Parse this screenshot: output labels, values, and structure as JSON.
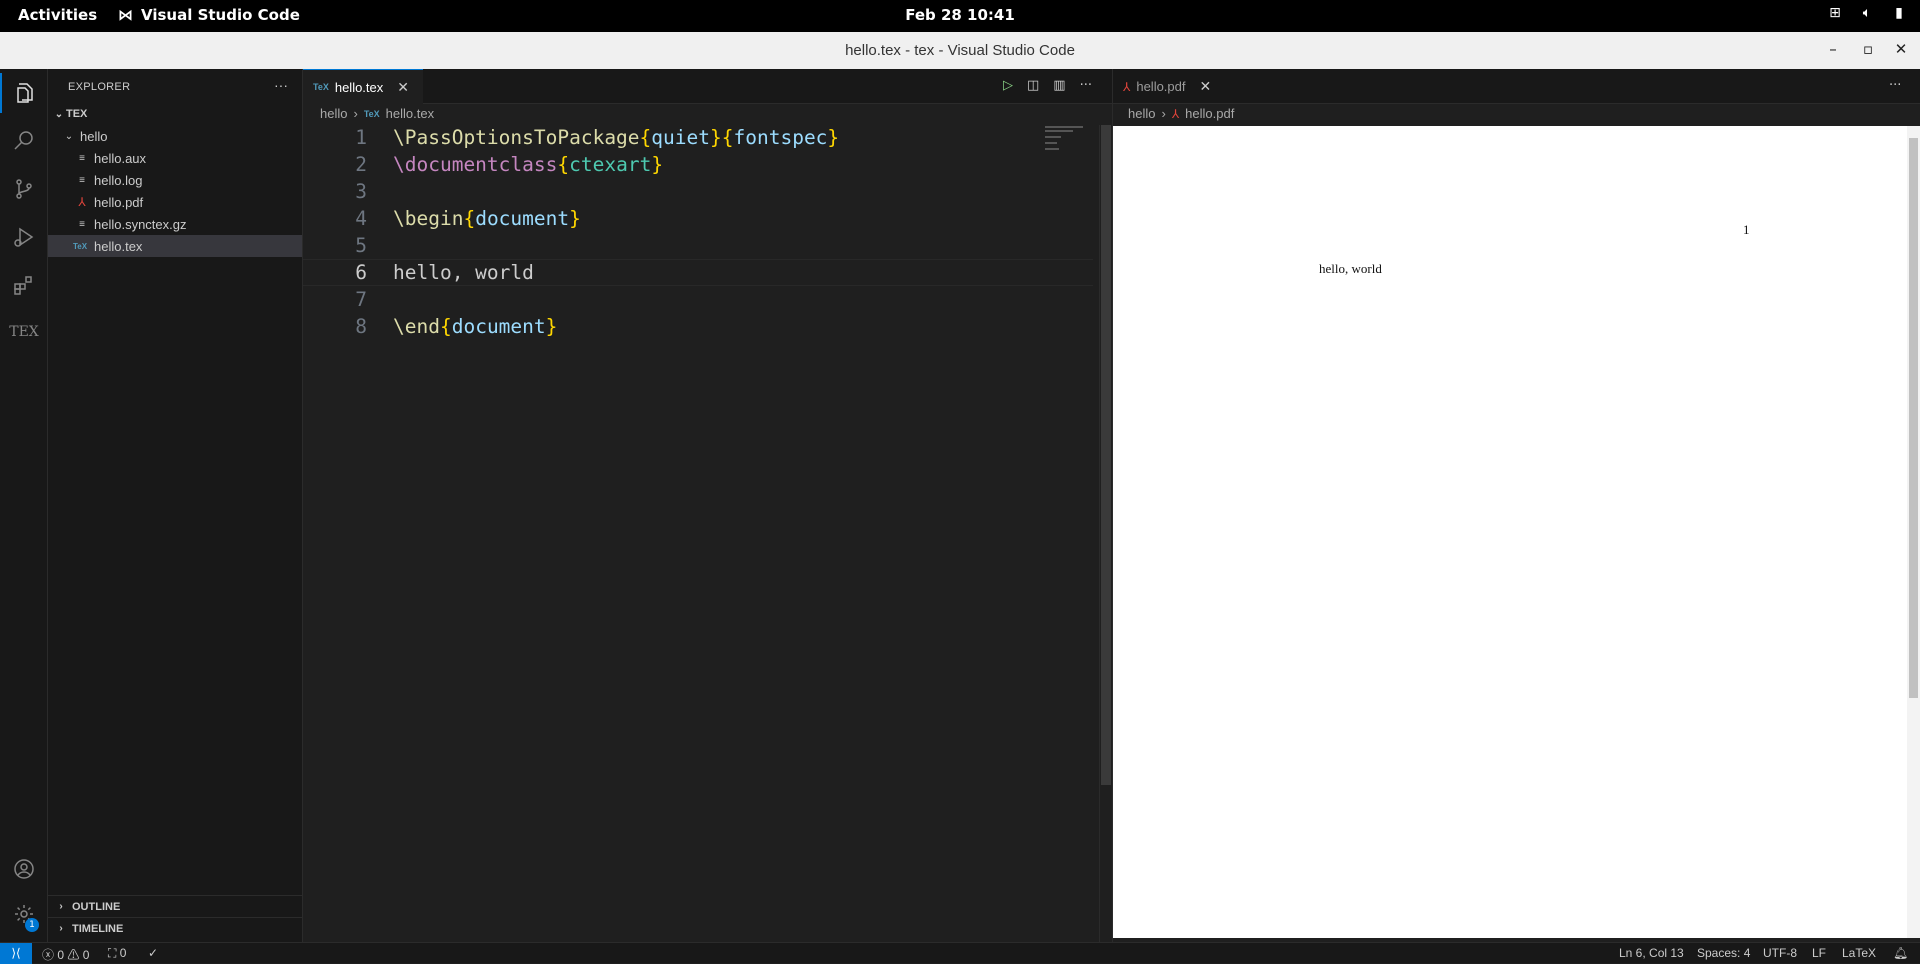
{
  "topbar": {
    "activities": "Activities",
    "app_name": "Visual Studio Code",
    "clock": "Feb 28  10:41"
  },
  "window": {
    "title": "hello.tex - tex - Visual Studio Code"
  },
  "sidebar": {
    "header": "EXPLORER",
    "root": "TEX",
    "folder": "hello",
    "files": [
      {
        "name": "hello.aux",
        "icon": "lines-icon"
      },
      {
        "name": "hello.log",
        "icon": "lines-icon"
      },
      {
        "name": "hello.pdf",
        "icon": "pdf-icon"
      },
      {
        "name": "hello.synctex.gz",
        "icon": "lines-icon"
      },
      {
        "name": "hello.tex",
        "icon": "tex-icon"
      }
    ],
    "outline": "OUTLINE",
    "timeline": "TIMELINE"
  },
  "editor": {
    "tab_label": "hello.tex",
    "tex_icon_text": "TeX",
    "breadcrumb": [
      "hello",
      "hello.tex"
    ],
    "lines": [
      {
        "n": "1",
        "parts": [
          [
            "cmd",
            "\\PassOptionsToPackage"
          ],
          [
            "br",
            "{"
          ],
          [
            "arg",
            "quiet"
          ],
          [
            "br",
            "}"
          ],
          [
            "br",
            "{"
          ],
          [
            "arg",
            "fontspec"
          ],
          [
            "br",
            "}"
          ]
        ]
      },
      {
        "n": "2",
        "parts": [
          [
            "cmd2",
            "\\documentclass"
          ],
          [
            "br",
            "{"
          ],
          [
            "arg2",
            "ctexart"
          ],
          [
            "br",
            "}"
          ]
        ]
      },
      {
        "n": "3",
        "parts": []
      },
      {
        "n": "4",
        "parts": [
          [
            "cmd",
            "\\begin"
          ],
          [
            "br",
            "{"
          ],
          [
            "arg",
            "document"
          ],
          [
            "br",
            "}"
          ]
        ]
      },
      {
        "n": "5",
        "parts": []
      },
      {
        "n": "6",
        "parts": [
          [
            "plain",
            "hello, world"
          ]
        ]
      },
      {
        "n": "7",
        "parts": []
      },
      {
        "n": "8",
        "parts": [
          [
            "cmd",
            "\\end"
          ],
          [
            "br",
            "{"
          ],
          [
            "arg",
            "document"
          ],
          [
            "br",
            "}"
          ]
        ]
      }
    ],
    "current_line": "6"
  },
  "pdf": {
    "tab_label": "hello.pdf",
    "breadcrumb": [
      "hello",
      "hello.pdf"
    ],
    "page_number": "1",
    "body_text": "hello, world"
  },
  "status": {
    "errors": "0",
    "warnings": "0",
    "ports": "0",
    "position": "Ln 6, Col 13",
    "spaces": "Spaces: 4",
    "encoding": "UTF-8",
    "eol": "LF",
    "language": "LaTeX",
    "settings_badge": "1"
  },
  "colors": {
    "accent": "#0078d4",
    "tex_icon": "#519aba",
    "pdf_icon": "#e0443b"
  }
}
